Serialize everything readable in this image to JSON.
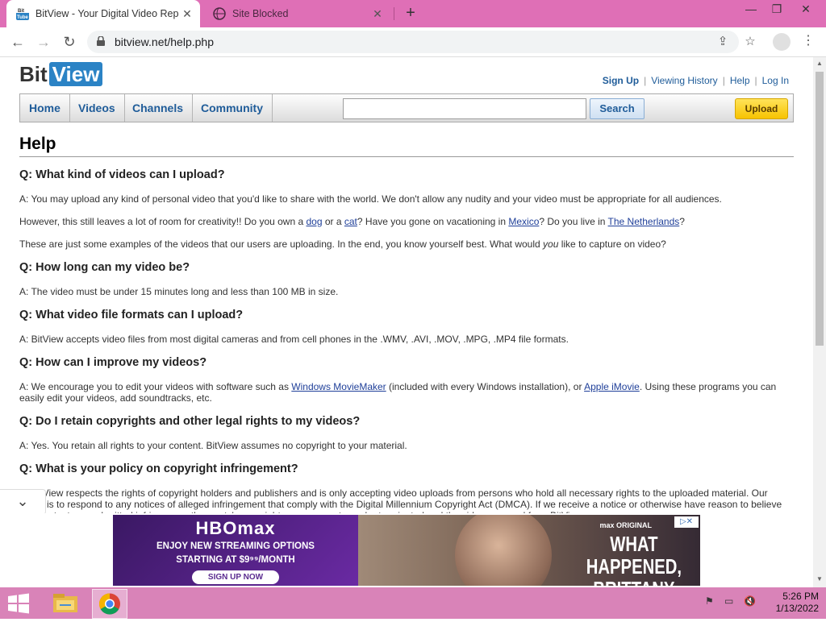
{
  "browser": {
    "tabs": [
      {
        "title": "BitView - Your Digital Video Repo",
        "active": true
      },
      {
        "title": "Site Blocked",
        "active": false
      }
    ],
    "new_tab_symbol": "+",
    "url": "bitview.net/help.php"
  },
  "site": {
    "logo_bit": "Bit",
    "logo_view": "View",
    "toplinks": {
      "signup": "Sign Up",
      "history": "Viewing History",
      "help": "Help",
      "login": "Log In"
    },
    "nav": [
      "Home",
      "Videos",
      "Channels",
      "Community"
    ],
    "search": {
      "value": "",
      "button": "Search"
    },
    "upload": "Upload"
  },
  "page": {
    "title": "Help",
    "faq": {
      "q1": "Q: What kind of videos can I upload?",
      "a1_p1": "A: You may upload any kind of personal video that you'd like to share with the world. We don't allow any nudity and your video must be appropriate for all audiences.",
      "a1_p2_a": "However, this still leaves a lot of room for creativity!! Do you own a ",
      "a1_p2_dog": "dog",
      "a1_p2_b": " or a ",
      "a1_p2_cat": "cat",
      "a1_p2_c": "? Have you gone on vacationing in ",
      "a1_p2_mexico": "Mexico",
      "a1_p2_d": "? Do you live in ",
      "a1_p2_nl": "The Netherlands",
      "a1_p2_e": "?",
      "a1_p3_a": "These are just some examples of the videos that our users are uploading. In the end, you know yourself best. What would ",
      "a1_p3_you": "you",
      "a1_p3_b": " like to capture on video?",
      "q2": "Q: How long can my video be?",
      "a2": "A: The video must be under 15 minutes long and less than 100 MB in size.",
      "q3": "Q: What video file formats can I upload?",
      "a3": "A: BitView accepts video files from most digital cameras and from cell phones in the .WMV, .AVI, .MOV, .MPG, .MP4 file formats.",
      "q4": "Q: How can I improve my videos?",
      "a4_a": "A: We encourage you to edit your videos with software such as ",
      "a4_wmm": "Windows MovieMaker",
      "a4_b": " (included with every Windows installation), or ",
      "a4_imovie": "Apple iMovie",
      "a4_c": ". Using these programs you can easily edit your videos, add soundtracks, etc.",
      "q5": "Q: Do I retain copyrights and other legal rights to my videos?",
      "a5": "A: Yes. You retain all rights to your content. BitView assumes no copyright to your material.",
      "q6": "Q: What is your policy on copyright infringement?",
      "a6": "A: BitView respects the rights of copyright holders and publishers and is only accepting video uploads from persons who hold all necessary rights to the uploaded material. Our policy is to respond to any notices of alleged infringement that comply with the Digital Millennium Copyright Act (DMCA). If we receive a notice or otherwise have reason to believe that content you submitted infringes another party's copyright, your account may be terminated and the video removed from BitView."
    }
  },
  "ad": {
    "brand": "HBOmax",
    "promo_line1": "ENJOY NEW STREAMING OPTIONS",
    "promo_line2": "STARTING AT $9⁹⁹/MONTH",
    "signup": "SIGN UP NOW",
    "max_original": "max ORIGINAL",
    "headline1": "WHAT HAPPENED,",
    "headline2": "BRITTANY MURPHY?"
  },
  "taskbar": {
    "time": "5:26 PM",
    "date": "1/13/2022"
  },
  "icons": [
    "bitview-favicon",
    "site-blocked-favicon",
    "back-icon",
    "forward-icon",
    "reload-icon",
    "lock-icon",
    "share-icon",
    "star-icon",
    "profile-icon",
    "menu-icon",
    "windows-start-icon",
    "file-explorer-icon",
    "chrome-icon"
  ]
}
